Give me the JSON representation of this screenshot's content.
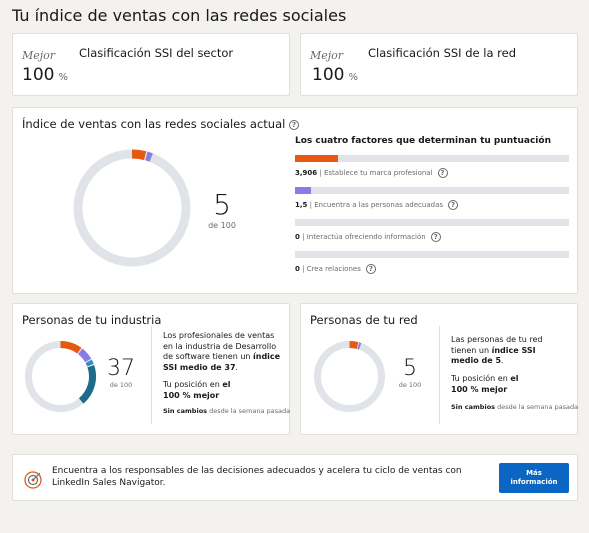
{
  "page_title": "Tu índice de ventas con las redes sociales",
  "rank_industry": {
    "best": "Mejor",
    "value": "100",
    "unit": "%",
    "title": "Clasificación SSI del sector"
  },
  "rank_network": {
    "best": "Mejor",
    "value": "100",
    "unit": "%",
    "title": "Clasificación SSI de la red"
  },
  "current": {
    "title": "Índice de ventas con las redes sociales actual",
    "score": "5",
    "of": "de 100",
    "factors_title": "Los cuatro factores que determinan tu puntuación",
    "factors": [
      {
        "value": "3,906",
        "label": "Establece tu marca profesional",
        "fraction": 0.156,
        "color": "#e55a0e"
      },
      {
        "value": "1,5",
        "label": "Encuentra a las personas adecuadas",
        "fraction": 0.06,
        "color": "#8a7be6"
      },
      {
        "value": "0",
        "label": "Interactúa ofreciendo información",
        "fraction": 0,
        "color": "#2a8fc1"
      },
      {
        "value": "0",
        "label": "Crea relaciones",
        "fraction": 0,
        "color": "#1f6b8a"
      }
    ]
  },
  "industry": {
    "title": "Personas de tu industria",
    "score": "37",
    "of": "de 100",
    "desc_pre": "Los profesionales de ventas en la industria de Desarrollo de software tienen un ",
    "desc_bold": "índice SSI medio de 37",
    "desc_post": ".",
    "pos_pre": "Tu posición en ",
    "pos_bold1": "el",
    "pos_bold2": "100 % mejor",
    "change_bold": "Sin cambios",
    "change_rest": "desde la semana pasada",
    "segments": [
      0.1,
      0.06,
      0.02,
      0.19
    ]
  },
  "network": {
    "title": "Personas de tu red",
    "score": "5",
    "of": "de 100",
    "desc_pre": "Las personas de tu red tienen un ",
    "desc_bold": "índice SSI medio de 5",
    "desc_post": ".",
    "pos_pre": "Tu posición en ",
    "pos_bold1": "el",
    "pos_bold2": "100 % mejor",
    "change_bold": "Sin cambios",
    "change_rest": "desde la semana pasada",
    "segments": [
      0.04,
      0.01,
      0,
      0
    ]
  },
  "promo": {
    "text": "Encuentra a los responsables de las decisiones adecuados y acelera tu ciclo de ventas con LinkedIn Sales Navigator.",
    "button_line1": "Más",
    "button_line2": "información"
  },
  "colors": {
    "orange": "#e55a0e",
    "purple": "#8a7be6",
    "blue": "#2a8fc1",
    "teal": "#1f6b8a",
    "track": "#e0e4e8",
    "accent": "#0a66c2"
  }
}
